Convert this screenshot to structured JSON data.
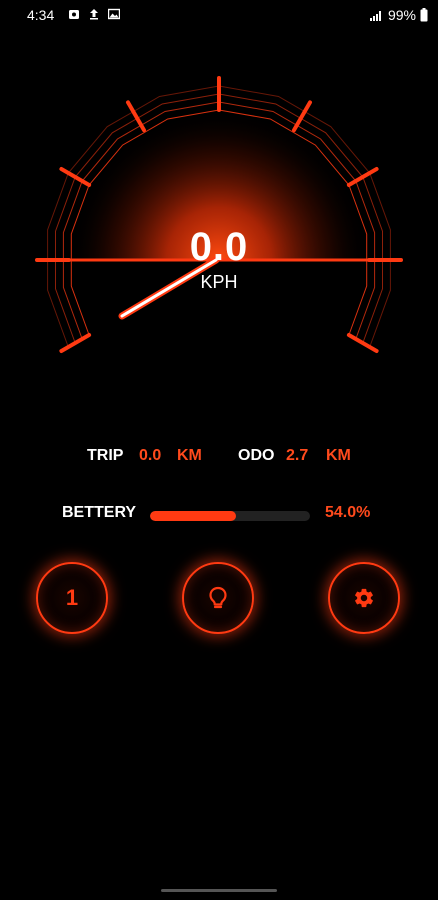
{
  "status": {
    "time": "4:34",
    "battery": "99%",
    "icons": [
      "camera-icon",
      "upload-icon",
      "image-icon",
      "signal-icon",
      "battery-icon"
    ]
  },
  "speedometer": {
    "speed": "0.0",
    "unit": "KPH",
    "accent_color": "#ff3a12"
  },
  "stats": {
    "trip_label": "TRIP",
    "trip_value": "0.0",
    "trip_unit": "KM",
    "odo_label": "ODO",
    "odo_value": "2.7",
    "odo_unit": "KM"
  },
  "battery": {
    "label": "BETTERY",
    "percent_text": "54.0%",
    "level": 0.54
  },
  "controls": {
    "mode_label": "1",
    "light_icon": "lightbulb-icon",
    "settings_icon": "gear-icon"
  }
}
